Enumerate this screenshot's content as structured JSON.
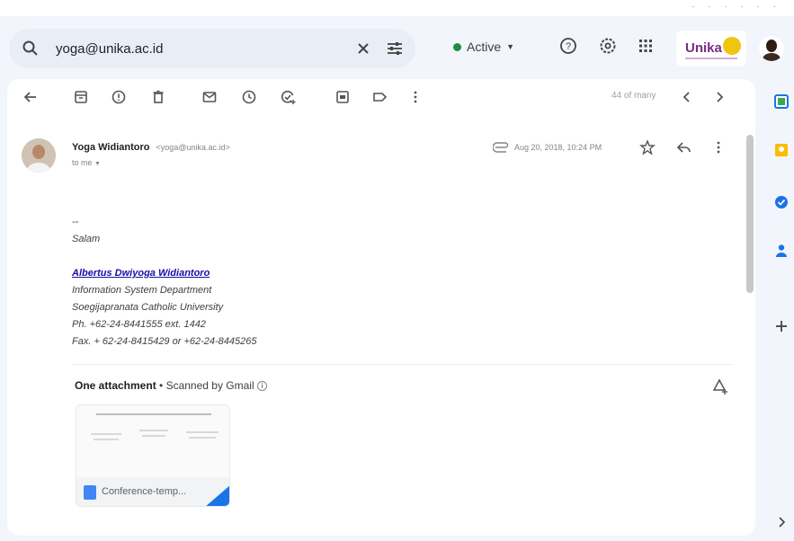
{
  "search": {
    "value": "yoga@unika.ac.id"
  },
  "status": {
    "label": "Active"
  },
  "brand": {
    "logo_text": "Unika"
  },
  "toolbar": {
    "pager": "44 of many"
  },
  "message": {
    "sender_name": "Yoga Widiantoro",
    "sender_email": "<yoga@unika.ac.id>",
    "to": "to me",
    "date": "Aug 20, 2018, 10:24 PM"
  },
  "body": {
    "dashes": "--",
    "greeting": "Salam",
    "signature_name": "Albertus Dwiyoga Widiantoro",
    "department": "Information System Department",
    "university": "Soegijapranata Catholic University",
    "phone": "Ph. +62-24-8441555 ext. 1442",
    "fax": "Fax. + 62-24-8415429  or  +62-24-8445265"
  },
  "attachment": {
    "count_label": "One attachment",
    "scanned_label": "• Scanned by Gmail",
    "file_name": "Conference-temp..."
  },
  "colors": {
    "accent": "#1a73e8",
    "active_green": "#1e8e3e",
    "brand_purple": "#7b2a86"
  }
}
